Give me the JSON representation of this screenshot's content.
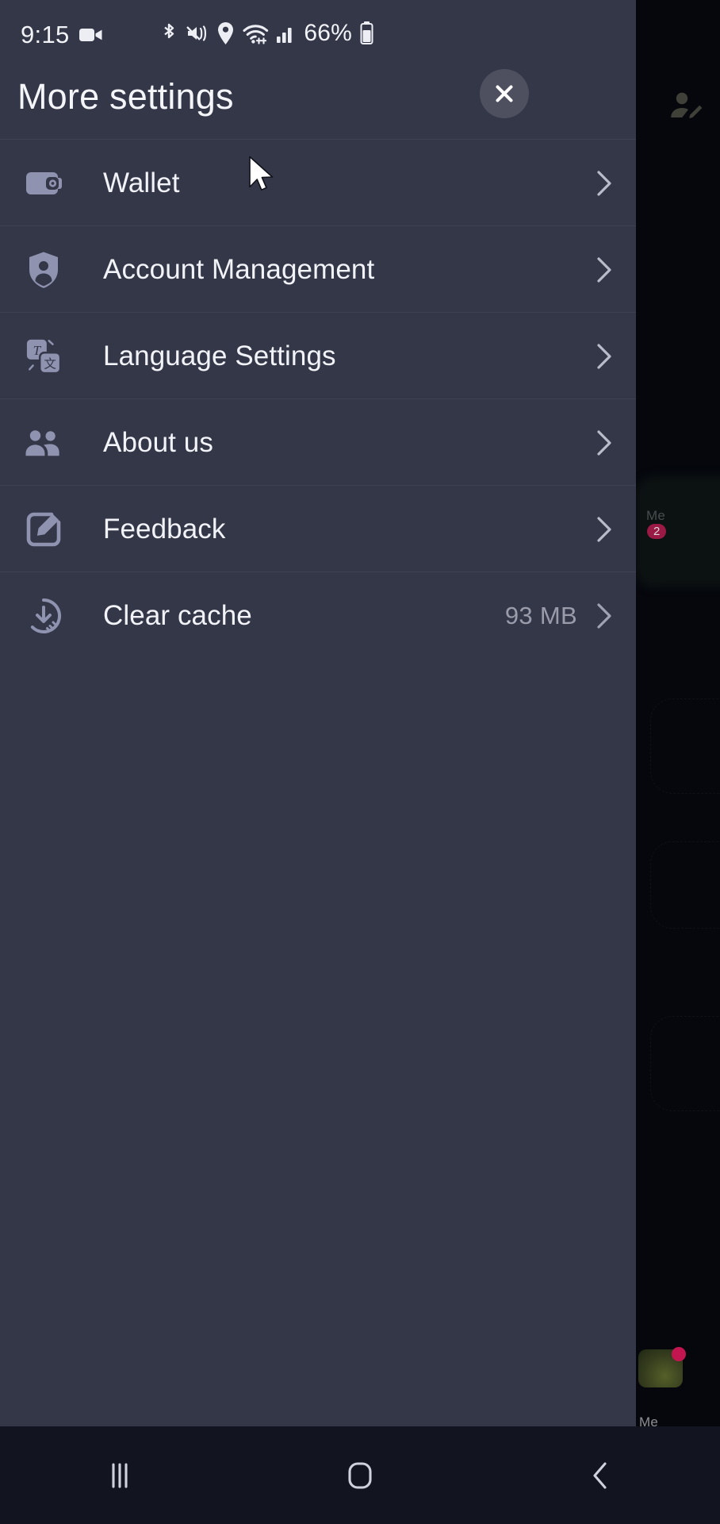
{
  "statusbar": {
    "time": "9:15",
    "battery_percent": "66%",
    "icons": [
      "video-camera-icon",
      "bluetooth-icon",
      "vibrate-mute-icon",
      "location-icon",
      "wifi-icon",
      "cellular-signal-icon",
      "battery-icon"
    ]
  },
  "header": {
    "title": "More settings",
    "close_label": "×",
    "close_icon": "close-icon"
  },
  "menu": {
    "items": [
      {
        "id": "wallet",
        "label": "Wallet",
        "icon": "wallet-icon",
        "value": "",
        "chevron": "chevron-right-icon"
      },
      {
        "id": "account-management",
        "label": "Account Management",
        "icon": "shield-user-icon",
        "value": "",
        "chevron": "chevron-right-icon"
      },
      {
        "id": "language-settings",
        "label": "Language Settings",
        "icon": "translate-icon",
        "value": "",
        "chevron": "chevron-right-icon"
      },
      {
        "id": "about-us",
        "label": "About us",
        "icon": "people-group-icon",
        "value": "",
        "chevron": "chevron-right-icon"
      },
      {
        "id": "feedback",
        "label": "Feedback",
        "icon": "edit-square-icon",
        "value": "",
        "chevron": "chevron-right-icon"
      },
      {
        "id": "clear-cache",
        "label": "Clear cache",
        "icon": "clear-cache-icon",
        "value": "93 MB",
        "chevron": "chevron-right-icon"
      }
    ]
  },
  "translate_icon_glyphs": {
    "latin": "T",
    "cjk": "文"
  },
  "background": {
    "me_tab_label": "Me",
    "badge_count": "2",
    "edit_profile_icon": "person-edit-icon"
  },
  "navbar": {
    "recents_label": "|||",
    "home_icon": "home-square-icon",
    "back_icon": "back-chevron-icon",
    "recents_icon": "recents-icon"
  },
  "colors": {
    "sheet_bg": "#343748",
    "app_bg": "#05070c",
    "nav_bg": "#121520",
    "icon_tint": "#8f93b0",
    "text_primary": "#f2f3f8",
    "text_secondary": "#9a9cab",
    "badge": "#b41b4e"
  }
}
